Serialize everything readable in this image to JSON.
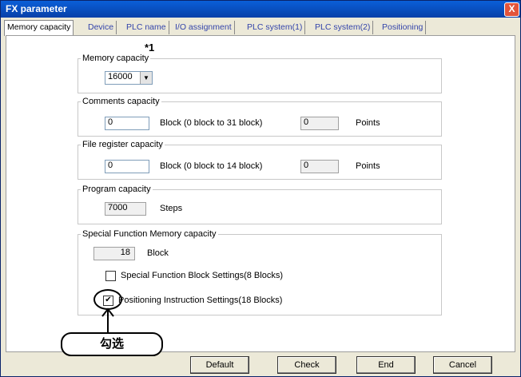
{
  "window": {
    "title": "FX parameter",
    "close_glyph": "X"
  },
  "tabs": [
    "Memory capacity",
    "Device",
    "PLC name",
    "I/O assignment",
    "PLC system(1)",
    "PLC system(2)",
    "Positioning"
  ],
  "note_mark": "*1",
  "memory": {
    "legend": "Memory capacity",
    "value": "16000"
  },
  "comments": {
    "legend": "Comments capacity",
    "value": "0",
    "range": "Block (0 block to 31 block)",
    "points_value": "0",
    "points_label": "Points"
  },
  "file_register": {
    "legend": "File register capacity",
    "value": "0",
    "range": "Block (0 block to 14 block)",
    "points_value": "0",
    "points_label": "Points"
  },
  "program": {
    "legend": "Program capacity",
    "value": "7000",
    "unit": "Steps"
  },
  "special": {
    "legend": "Special Function Memory capacity",
    "block_value": "18",
    "block_label": "Block",
    "option1": "Special Function Block Settings(8 Blocks)",
    "option1_checked": false,
    "option2": "Positioning Instruction Settings(18 Blocks)",
    "option2_checked": true
  },
  "callout": "勾选",
  "buttons": {
    "default": "Default",
    "check": "Check",
    "end": "End",
    "cancel": "Cancel"
  }
}
